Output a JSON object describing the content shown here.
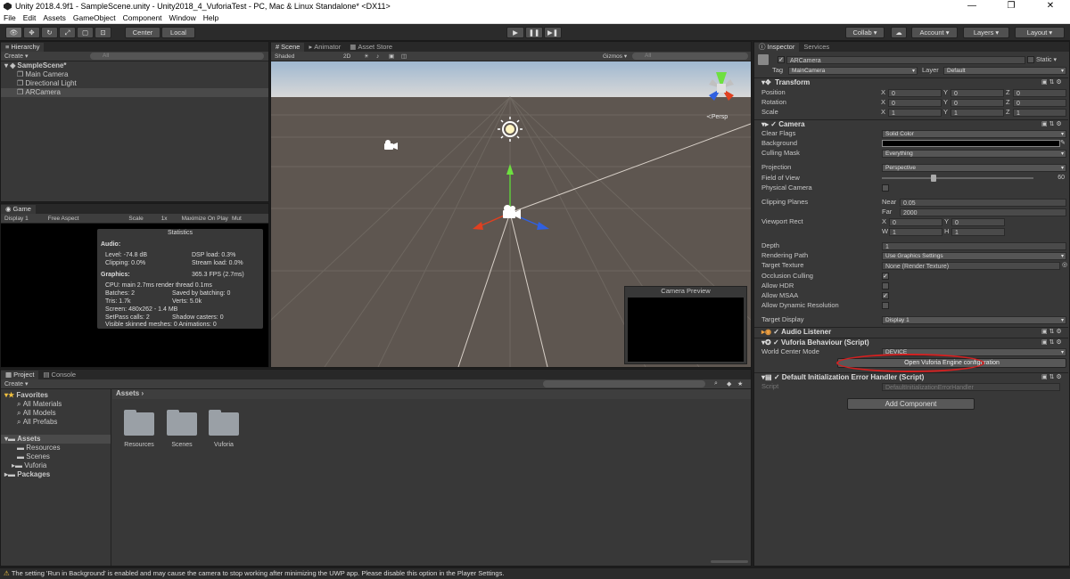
{
  "window": {
    "title": "Unity 2018.4.9f1 - SampleScene.unity - Unity2018_4_VuforiaTest - PC, Mac & Linux Standalone* <DX11>",
    "min": "—",
    "max": "❐",
    "close": "✕"
  },
  "menu": [
    "File",
    "Edit",
    "Assets",
    "GameObject",
    "Component",
    "Window",
    "Help"
  ],
  "toolbar": {
    "center": "Center",
    "local": "Local",
    "collab": "Collab ▾",
    "account": "Account",
    "layers": "Layers",
    "layout": "Layout",
    "play": "▶",
    "pause": "❚❚",
    "step": "▶❚"
  },
  "hierarchy": {
    "tab": "Hierarchy",
    "create": "Create ▾",
    "search": "All",
    "scene": "SampleScene*",
    "items": [
      "Main Camera",
      "Directional Light",
      "ARCamera"
    ]
  },
  "game": {
    "tab": "Game",
    "display": "Display 1",
    "aspect": "Free Aspect",
    "scale": "Scale",
    "scale_val": "1x",
    "maximize": "Maximize On Play",
    "mute": "Mut"
  },
  "stats": {
    "title": "Statistics",
    "audio_label": "Audio:",
    "level": "Level: -74.8 dB",
    "clipping": "Clipping: 0.0%",
    "dsp": "DSP load: 0.3%",
    "stream": "Stream load: 0.0%",
    "graphics_label": "Graphics:",
    "fps": "365.3 FPS (2.7ms)",
    "cpu": "CPU: main 2.7ms render thread 0.1ms",
    "batches": "Batches: 2",
    "saved": "Saved by batching: 0",
    "tris": "Tris: 1.7k",
    "verts": "Verts: 5.0k",
    "screen": "Screen: 480x262 - 1.4 MB",
    "setpass": "SetPass calls: 2",
    "shadow": "Shadow casters: 0",
    "skinned": "Visible skinned meshes: 0 Animations: 0"
  },
  "scene": {
    "tabs": [
      "Scene",
      "Animator",
      "Asset Store"
    ],
    "shaded": "Shaded",
    "mode2d": "2D",
    "gizmos": "Gizmos ▾",
    "search": "All",
    "persp": "≺Persp",
    "preview": "Camera Preview"
  },
  "project": {
    "tabs": [
      "Project",
      "Console"
    ],
    "create": "Create ▾",
    "favorites": "Favorites",
    "fav_items": [
      "All Materials",
      "All Models",
      "All Prefabs"
    ],
    "assets": "Assets",
    "asset_items": [
      "Resources",
      "Scenes",
      "Vuforia"
    ],
    "packages": "Packages",
    "breadcrumb": "Assets",
    "folders": [
      "Resources",
      "Scenes",
      "Vuforia"
    ]
  },
  "inspector": {
    "tabs": [
      "Inspector",
      "Services"
    ],
    "object": "ARCamera",
    "static": "Static ▾",
    "tag_label": "Tag",
    "tag": "MainCamera",
    "layer_label": "Layer",
    "layer": "Default",
    "transform": {
      "title": "Transform",
      "rows": [
        {
          "label": "Position",
          "x": "0",
          "y": "0",
          "z": "0"
        },
        {
          "label": "Rotation",
          "x": "0",
          "y": "0",
          "z": "0"
        },
        {
          "label": "Scale",
          "x": "1",
          "y": "1",
          "z": "1"
        }
      ]
    },
    "camera": {
      "title": "Camera",
      "clear_flags": "Clear Flags",
      "clear_val": "Solid Color",
      "background": "Background",
      "culling": "Culling Mask",
      "culling_val": "Everything",
      "projection": "Projection",
      "projection_val": "Perspective",
      "fov": "Field of View",
      "fov_val": "60",
      "physical": "Physical Camera",
      "clipping": "Clipping Planes",
      "near_label": "Near",
      "near": "0.05",
      "far_label": "Far",
      "far": "2000",
      "viewport": "Viewport Rect",
      "vx": "0",
      "vy": "0",
      "vw": "1",
      "vh": "1",
      "depth": "Depth",
      "depth_val": "1",
      "rendering": "Rendering Path",
      "rendering_val": "Use Graphics Settings",
      "target": "Target Texture",
      "target_val": "None (Render Texture)",
      "occlusion": "Occlusion Culling",
      "hdr": "Allow HDR",
      "msaa": "Allow MSAA",
      "dynres": "Allow Dynamic Resolution",
      "display": "Target Display",
      "display_val": "Display 1"
    },
    "audio": {
      "title": "Audio Listener"
    },
    "vuforia": {
      "title": "Vuforia Behaviour (Script)",
      "world": "World Center Mode",
      "world_val": "DEVICE",
      "button": "Open Vuforia Engine configuration"
    },
    "error": {
      "title": "Default Initialization Error Handler (Script)",
      "script_label": "Script",
      "script_val": "DefaultInitializationErrorHandler"
    },
    "add_component": "Add Component"
  },
  "status": {
    "message": "The setting 'Run in Background' is enabled and may cause the camera to stop working after minimizing the UWP app. Please disable this option in the Player Settings."
  },
  "colors": {
    "accent": "#3e5f96",
    "highlight_ring": "#d42020",
    "warning": "#f0c040"
  }
}
